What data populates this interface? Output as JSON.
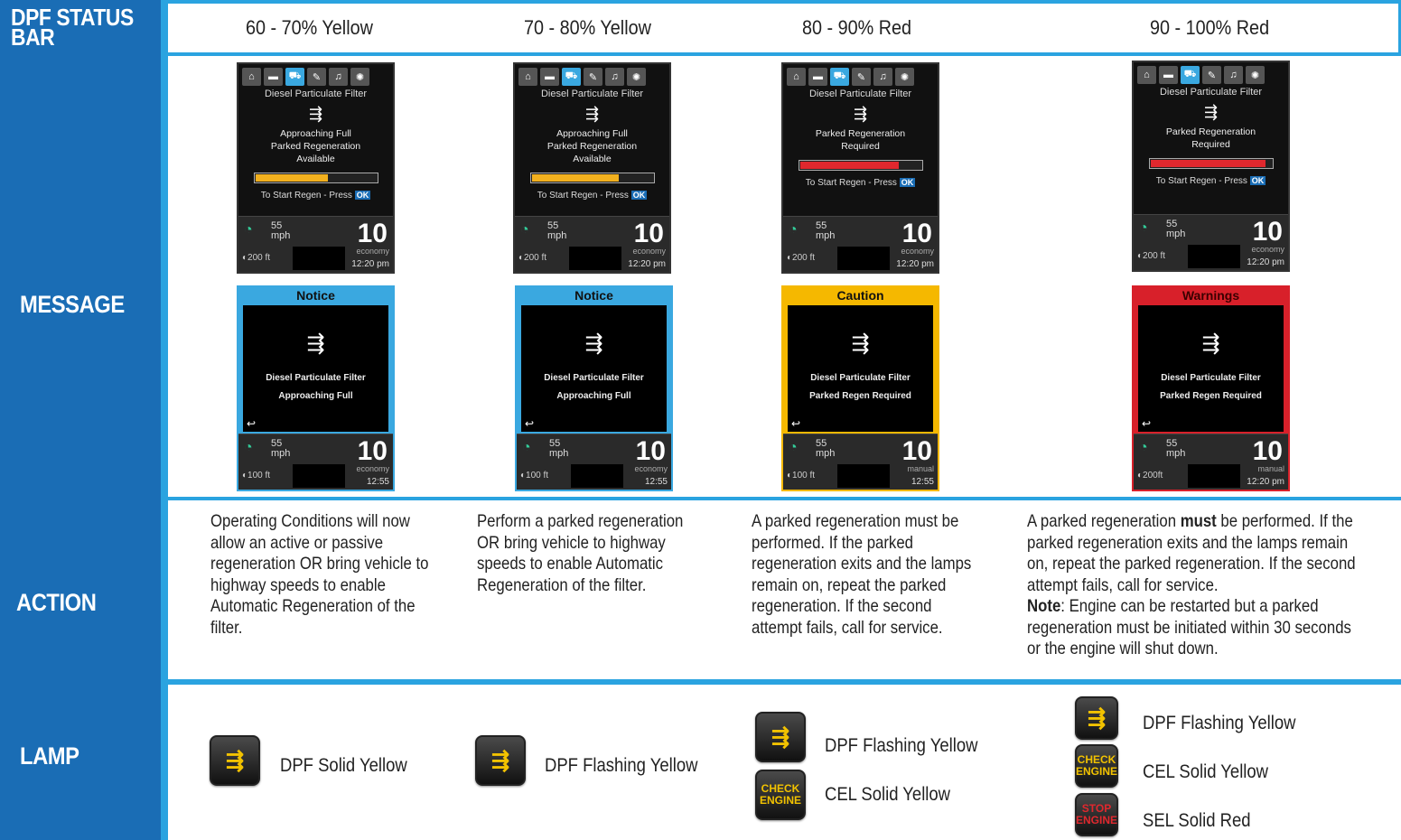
{
  "row_labels": {
    "status": "DPF STATUS BAR",
    "message": "MESSAGE",
    "action": "ACTION",
    "lamp": "LAMP"
  },
  "columns": [
    {
      "header": "60 - 70% Yellow",
      "top_screen": {
        "icons": [
          "home-icon",
          "truck-icon",
          "dpf-icon",
          "wrench-icon",
          "music-icon",
          "settings-icon"
        ],
        "title": "Diesel Particulate Filter",
        "lines": [
          "Approaching Full",
          "Parked Regeneration",
          "Available"
        ],
        "bar_color": "#f2b01e",
        "bar_fill": 0.6,
        "start": "To Start Regen - Press",
        "ok": "OK",
        "speed": "55",
        "speed_unit": "mph",
        "big": "10",
        "altitude": "200 ft",
        "mode": "economy",
        "time": "12:20 pm"
      },
      "alert_screen": {
        "header": "Notice",
        "header_color": "#3aa8e0",
        "header_text_color": "#111111",
        "line1": "Diesel Particulate Filter",
        "line2": "Approaching Full",
        "speed": "55",
        "speed_unit": "mph",
        "big": "10",
        "altitude": "100 ft",
        "mode": "economy",
        "time": "12:55"
      },
      "action": "Operating Conditions will now allow an active or passive regeneration OR bring vehicle to highway speeds to enable Automatic Regeneration of the filter.",
      "lamps": [
        {
          "type": "dpf",
          "label": "DPF Solid Yellow"
        }
      ]
    },
    {
      "header": "70 - 80% Yellow",
      "top_screen": {
        "icons": [
          "home-icon",
          "truck-icon",
          "dpf-icon",
          "wrench-icon",
          "music-icon",
          "settings-icon"
        ],
        "title": "Diesel Particulate Filter",
        "lines": [
          "Approaching Full",
          "Parked Regeneration",
          "Available"
        ],
        "bar_color": "#f2b01e",
        "bar_fill": 0.72,
        "start": "To Start Regen - Press",
        "ok": "OK",
        "speed": "55",
        "speed_unit": "mph",
        "big": "10",
        "altitude": "200 ft",
        "mode": "economy",
        "time": "12:20 pm"
      },
      "alert_screen": {
        "header": "Notice",
        "header_color": "#3aa8e0",
        "header_text_color": "#111111",
        "line1": "Diesel Particulate Filter",
        "line2": "Approaching Full",
        "speed": "55",
        "speed_unit": "mph",
        "big": "10",
        "altitude": "100 ft",
        "mode": "economy",
        "time": "12:55"
      },
      "action": "Perform a parked regeneration OR bring vehicle to highway speeds to enable Automatic Regeneration of the filter.",
      "lamps": [
        {
          "type": "dpf",
          "label": "DPF Flashing Yellow"
        }
      ]
    },
    {
      "header": "80 - 90% Red",
      "top_screen": {
        "icons": [
          "home-icon",
          "truck-icon",
          "dpf-icon",
          "wrench-icon",
          "music-icon",
          "settings-icon"
        ],
        "title": "Diesel Particulate Filter",
        "lines": [
          "Parked Regeneration",
          "Required"
        ],
        "bar_color": "#e0282e",
        "bar_fill": 0.82,
        "start": "To Start Regen - Press",
        "ok": "OK",
        "speed": "55",
        "speed_unit": "mph",
        "big": "10",
        "altitude": "200 ft",
        "mode": "economy",
        "time": "12:20 pm"
      },
      "alert_screen": {
        "header": "Caution",
        "header_color": "#f5b800",
        "header_text_color": "#111111",
        "line1": "Diesel Particulate Filter",
        "line2": "Parked Regen Required",
        "speed": "55",
        "speed_unit": "mph",
        "big": "10",
        "altitude": "100 ft",
        "mode": "manual",
        "time": "12:55"
      },
      "action": "A parked regeneration must be performed.  If the parked regeneration exits and the lamps remain on, repeat the parked regeneration.  If the second attempt fails, call for service.",
      "lamps": [
        {
          "type": "dpf",
          "label": "DPF Flashing Yellow"
        },
        {
          "type": "cel",
          "label": "CEL Solid Yellow"
        }
      ]
    },
    {
      "header": "90 - 100% Red",
      "top_screen": {
        "icons": [
          "home-icon",
          "truck-icon",
          "dpf-icon",
          "wrench-icon",
          "music-icon",
          "settings-icon"
        ],
        "title": "Diesel Particulate Filter",
        "lines": [
          "Parked Regeneration",
          "Required"
        ],
        "bar_color": "#e0282e",
        "bar_fill": 0.95,
        "start": "To Start Regen - Press",
        "ok": "OK",
        "speed": "55",
        "speed_unit": "mph",
        "big": "10",
        "altitude": "200 ft",
        "mode": "economy",
        "time": "12:20 pm"
      },
      "alert_screen": {
        "header": "Warnings",
        "header_color": "#d8202a",
        "header_text_color": "#3a0000",
        "line1": "Diesel Particulate Filter",
        "line2": "Parked Regen Required",
        "speed": "55",
        "speed_unit": "mph",
        "big": "10",
        "altitude": "200ft",
        "mode": "manual",
        "time": "12:20 pm"
      },
      "action_parts": {
        "a": "A parked regeneration ",
        "must": "must",
        "b": " be performed.  If the parked regeneration exits and the lamps remain on, repeat the parked regeneration.  If the second attempt fails, call for service.",
        "note": "Note",
        "c": ": Engine can be restarted but a parked regeneration must be initiated within 30 seconds or the engine will shut down."
      },
      "lamps": [
        {
          "type": "dpf",
          "label": "DPF Flashing Yellow"
        },
        {
          "type": "cel",
          "label": "CEL Solid Yellow"
        },
        {
          "type": "sel",
          "label": "SEL Solid Red"
        }
      ]
    }
  ],
  "lamp_text": {
    "check": "CHECK",
    "engine": "ENGINE",
    "stop": "STOP",
    "dpf_symbol": "⇶",
    "alt_prefix": "◐"
  },
  "colors": {
    "left_column": "#1a6db5",
    "accent_strip": "#2aa3e0",
    "lamp_yellow": "#f2c200",
    "lamp_red": "#e0282e"
  }
}
